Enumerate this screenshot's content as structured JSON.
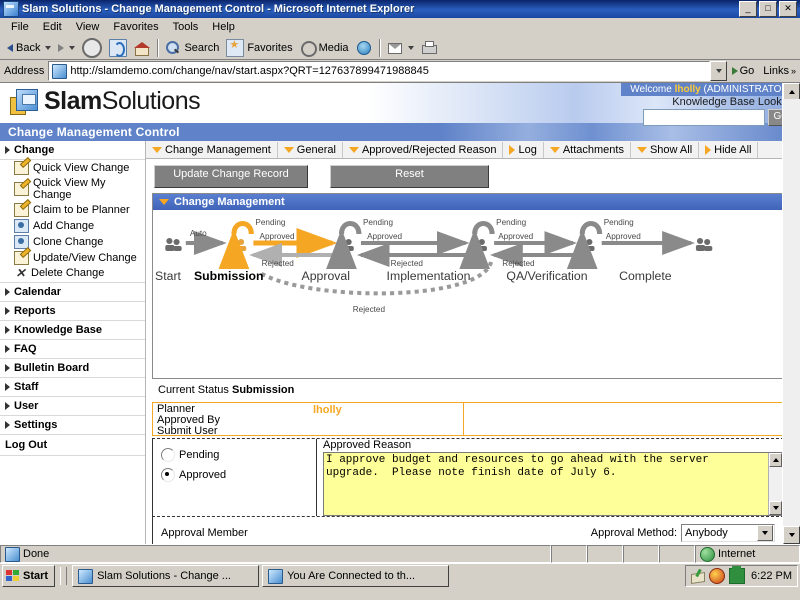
{
  "window": {
    "title": "Slam Solutions - Change Management Control - Microsoft Internet Explorer",
    "minimize_label": "_",
    "maximize_label": "□",
    "close_label": "✕"
  },
  "menu": {
    "items": [
      "File",
      "Edit",
      "View",
      "Favorites",
      "Tools",
      "Help"
    ]
  },
  "toolbar": {
    "back": "Back",
    "forward": "",
    "stop": "",
    "refresh": "",
    "home": "",
    "search": "Search",
    "favorites": "Favorites",
    "media": "Media",
    "history": "",
    "mail": "",
    "print": ""
  },
  "address": {
    "label": "Address",
    "url": "http://slamdemo.com/change/nav/start.aspx?QRT=127637899471988845",
    "go_label": "Go",
    "links_label": "Links"
  },
  "banner": {
    "logo_bold": "Slam",
    "logo_light": "Solutions",
    "welcome_prefix": "Welcome",
    "welcome_user": "lholly",
    "welcome_role": "(ADMINISTRATOR)",
    "kb_label": "Knowledge Base Lookup",
    "kb_value": "",
    "kb_placeholder": "",
    "kb_go": "GO",
    "subtitle": "Change Management Control"
  },
  "sidebar": {
    "groups": [
      {
        "label": "Change",
        "items": [
          {
            "label": "Quick View Change",
            "icon": "edit-icon"
          },
          {
            "label": "Quick View My Change",
            "icon": "edit-icon"
          },
          {
            "label": "Claim to be Planner",
            "icon": "edit-icon"
          },
          {
            "label": "Add Change",
            "icon": "user-icon"
          },
          {
            "label": "Clone Change",
            "icon": "user-icon"
          },
          {
            "label": "Update/View Change",
            "icon": "edit-icon"
          },
          {
            "label": "Delete Change",
            "icon": "delete-icon"
          }
        ]
      },
      {
        "label": "Calendar",
        "items": []
      },
      {
        "label": "Reports",
        "items": []
      },
      {
        "label": "Knowledge Base",
        "items": []
      },
      {
        "label": "FAQ",
        "items": []
      },
      {
        "label": "Bulletin Board",
        "items": []
      },
      {
        "label": "Staff",
        "items": []
      },
      {
        "label": "User",
        "items": []
      },
      {
        "label": "Settings",
        "items": []
      }
    ],
    "logout": "Log Out"
  },
  "tabs": [
    {
      "label": "Change Management",
      "icon": "triangle-down-icon"
    },
    {
      "label": "General",
      "icon": "triangle-down-icon"
    },
    {
      "label": "Approved/Rejected Reason",
      "icon": "triangle-down-icon"
    },
    {
      "label": "Log",
      "icon": "triangle-right-icon"
    },
    {
      "label": "Attachments",
      "icon": "triangle-down-icon"
    },
    {
      "label": "Show All",
      "icon": "triangle-down-icon"
    },
    {
      "label": "Hide All",
      "icon": "triangle-right-icon"
    }
  ],
  "actions": {
    "update": "Update Change Record",
    "reset": "Reset"
  },
  "panel": {
    "title": "Change Management"
  },
  "workflow": {
    "stages": [
      "Start",
      "Submission",
      "Approval",
      "Implementation",
      "QA/Verification",
      "Complete"
    ],
    "current_stage": "Submission",
    "transition_auto": "Auto",
    "label_pending": "Pending",
    "label_approved": "Approved",
    "label_rejected": "Rejected"
  },
  "status": {
    "label": "Current Status",
    "value": "Submission"
  },
  "record": {
    "rows": [
      "Planner",
      "Approved By",
      "Submit User"
    ],
    "planner_value": "lholly"
  },
  "approval": {
    "options": [
      {
        "label": "Pending",
        "selected": false
      },
      {
        "label": "Approved",
        "selected": true
      }
    ],
    "reason_label": "Approved Reason",
    "reason_text": "I approve budget and resources to go ahead with the server upgrade.  Please note finish date of July 6.",
    "member_label": "Approval Member",
    "method_label": "Approval Method:",
    "method_value": "Anybody"
  },
  "statusbar": {
    "text": "Done",
    "zone": "Internet"
  },
  "taskbar": {
    "start": "Start",
    "tasks": [
      "Slam Solutions - Change ...",
      "You Are Connected to th..."
    ],
    "clock": "6:22 PM"
  },
  "colors": {
    "accent_orange": "#f5a623",
    "brand_blue": "#5f82c8",
    "title_blue": "#0a246a",
    "textarea_yellow": "#ffff99"
  }
}
